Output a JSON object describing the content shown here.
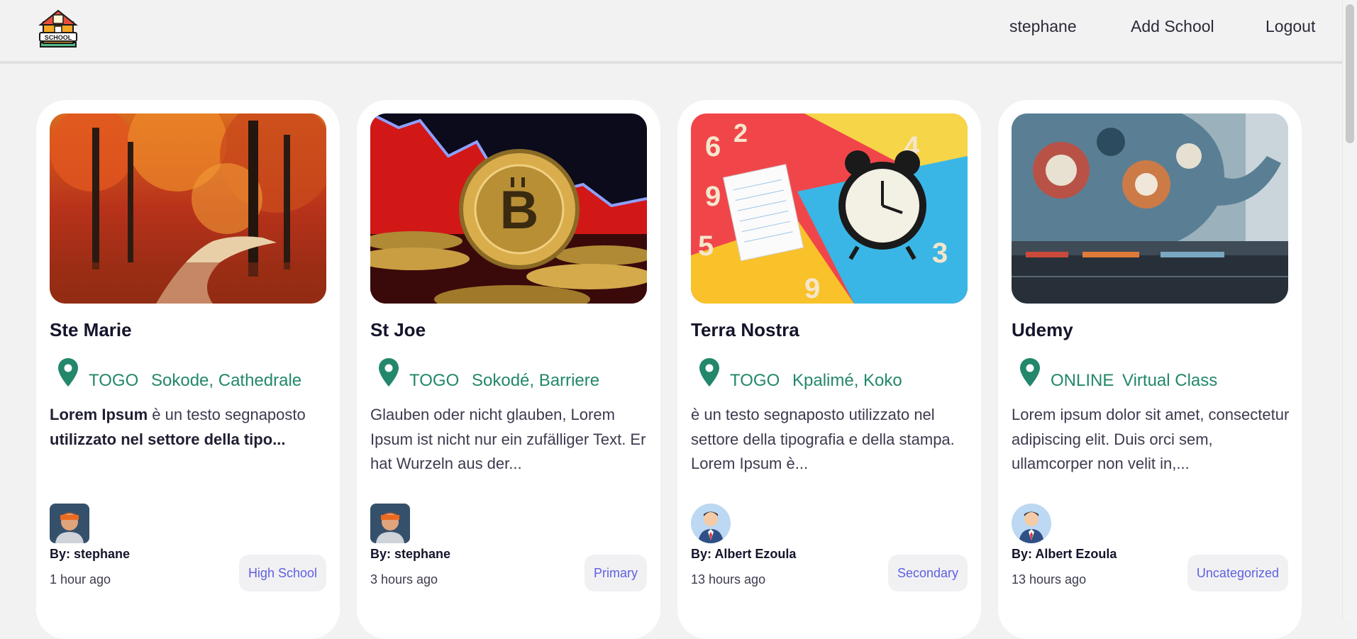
{
  "header": {
    "logo_text": "SCHOOL",
    "nav": {
      "user": "stephane",
      "add_school": "Add School",
      "logout": "Logout"
    }
  },
  "colors": {
    "location": "#23876b",
    "badge_text": "#6060e0",
    "badge_bg": "#f1f1f4"
  },
  "cards": [
    {
      "title": "Ste Marie",
      "country": "TOGO",
      "city": "Sokode, Cathedrale",
      "desc": {
        "p1": "Lorem Ipsum",
        "p2": " è un testo segnaposto ",
        "p3": "utilizzato nel settore della tipo..."
      },
      "author": "By: stephane",
      "time": "1 hour ago",
      "category": "High School",
      "image": "autumn-forest-photo",
      "avatar": "user-photo"
    },
    {
      "title": "St Joe",
      "country": "TOGO",
      "city": "Sokodé, Barriere",
      "desc": "Glauben oder nicht glauben, Lorem Ipsum ist nicht nur ein zufälliger Text. Er hat Wurzeln aus der...",
      "author": "By: stephane",
      "time": "3 hours ago",
      "category": "Primary",
      "image": "bitcoin-photo",
      "avatar": "user-photo"
    },
    {
      "title": "Terra Nostra",
      "country": "TOGO",
      "city": "Kpalimé, Koko",
      "desc": " è un testo segnaposto utilizzato nel settore della tipografia e della stampa. Lorem Ipsum è...",
      "author": "By: Albert Ezoula",
      "time": "13 hours ago",
      "category": "Secondary",
      "image": "alarm-clock-photo",
      "avatar": "default-avatar"
    },
    {
      "title": "Udemy",
      "country": "ONLINE",
      "city": "Virtual Class",
      "desc": "Lorem ipsum dolor sit amet, consectetur adipiscing elit. Duis orci sem, ullamcorper non velit in,...",
      "author": "By: Albert Ezoula",
      "time": "13 hours ago",
      "category": "Uncategorized",
      "image": "elephant-mural-photo",
      "avatar": "default-avatar"
    }
  ]
}
